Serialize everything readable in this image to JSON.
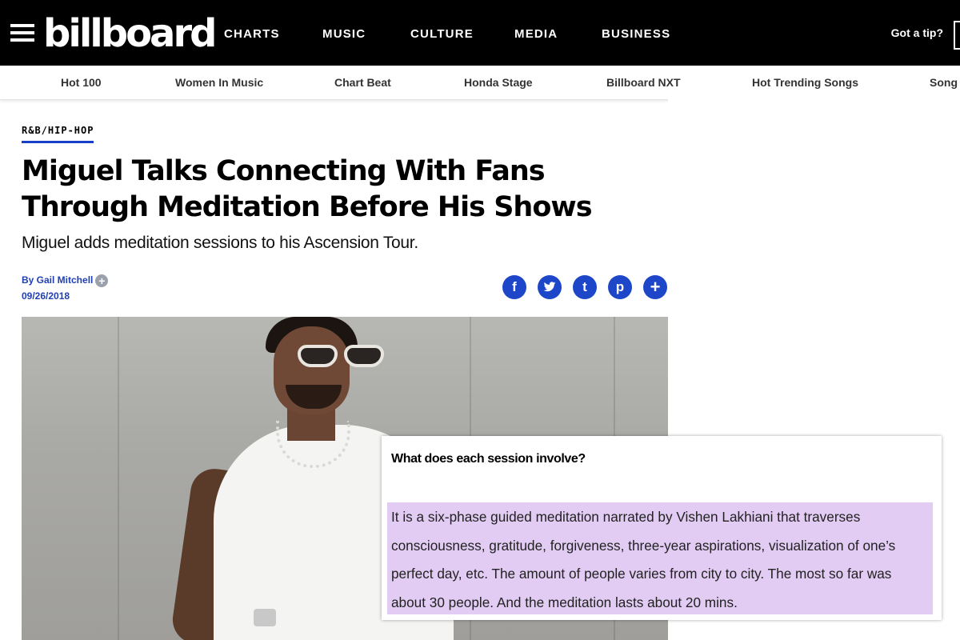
{
  "header": {
    "logo": "billboard",
    "nav": [
      "CHARTS",
      "MUSIC",
      "CULTURE",
      "MEDIA",
      "BUSINESS"
    ],
    "tip_label": "Got a tip?"
  },
  "subnav": [
    "Hot 100",
    "Women In Music",
    "Chart Beat",
    "Honda Stage",
    "Billboard NXT",
    "Hot Trending Songs",
    "Song"
  ],
  "article": {
    "section": "R&B/HIP-HOP",
    "headline": "Miguel Talks Connecting With Fans Through Meditation Before His Shows",
    "dek": "Miguel adds meditation sessions to his Ascension Tour.",
    "byline": "By Gail Mitchell",
    "date": "09/26/2018"
  },
  "share": [
    {
      "icon": "facebook-icon",
      "glyph": "f"
    },
    {
      "icon": "twitter-icon",
      "glyph": "🐦"
    },
    {
      "icon": "tumblr-icon",
      "glyph": "t"
    },
    {
      "icon": "pinterest-icon",
      "glyph": "p"
    },
    {
      "icon": "more-icon",
      "glyph": "+"
    }
  ],
  "overlay": {
    "question": "What does each session involve?",
    "answer_lines": [
      "It is a six-phase guided meditation narrated by Vishen Lakhiani that traverses",
      "consciousness, gratitude, forgiveness, three-year aspirations, visualization of one’s",
      "perfect day, etc. The amount of people varies from city to city. The most so far was",
      "about 30 people. And the meditation lasts about 20 mins."
    ],
    "highlight_color": "#e2ccf3"
  }
}
